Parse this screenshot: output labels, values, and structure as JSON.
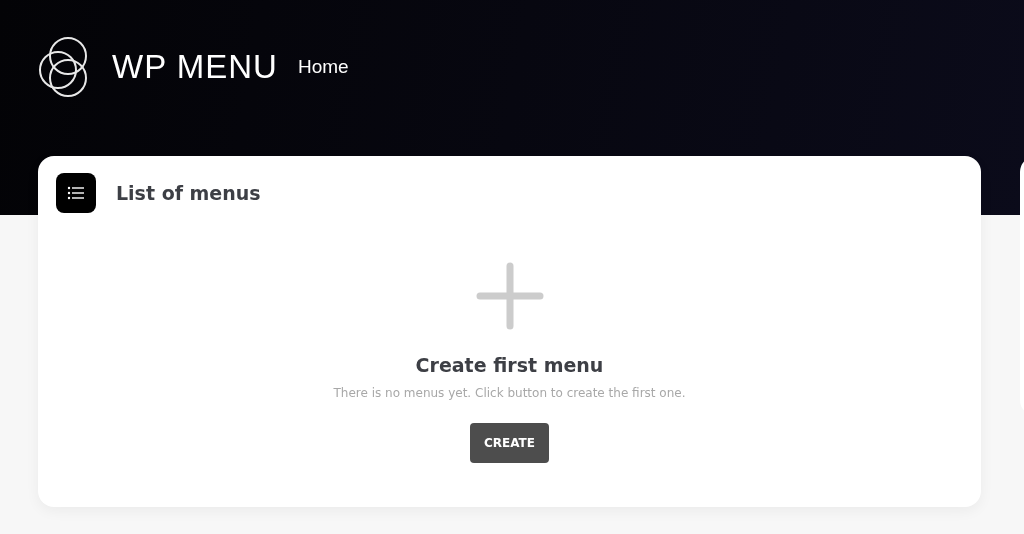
{
  "header": {
    "brand": "WP MENU",
    "nav": [
      {
        "label": "Home"
      }
    ]
  },
  "card": {
    "title": "List of menus",
    "empty_state": {
      "heading": "Create first menu",
      "message": "There is no menus yet. Click button to create the first one.",
      "button": "CREATE"
    }
  }
}
